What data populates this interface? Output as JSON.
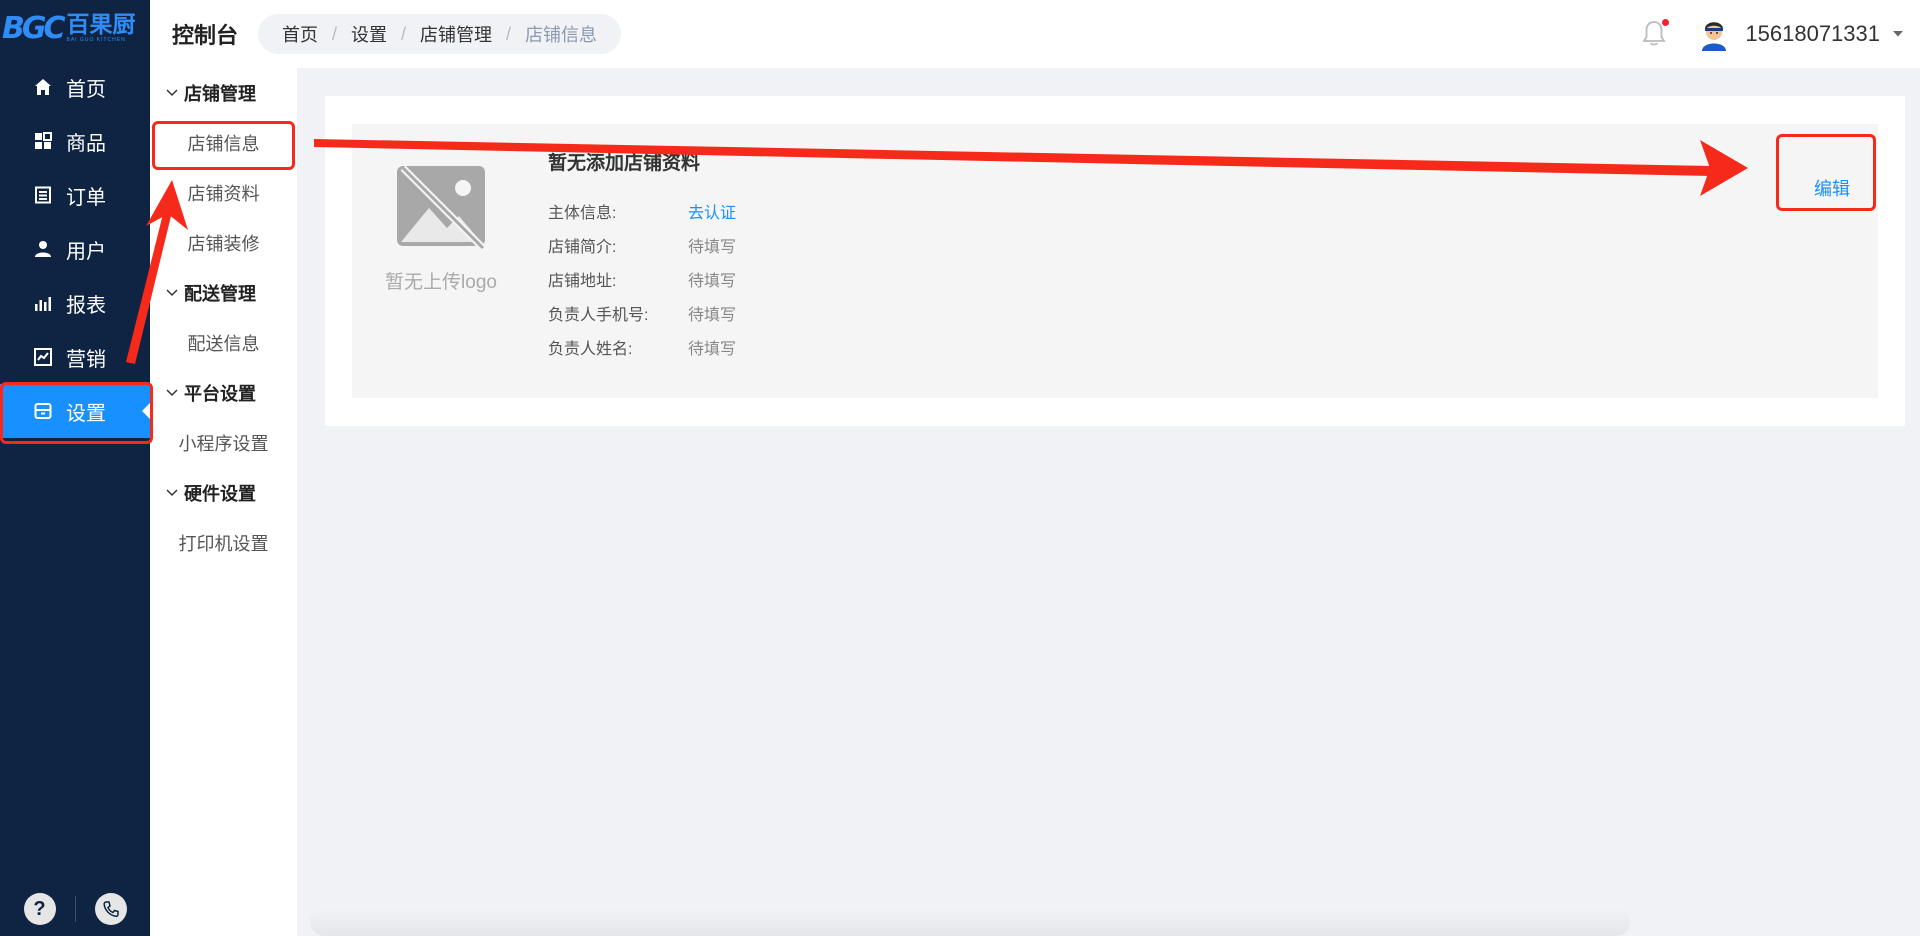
{
  "brand": {
    "mark": "BGC",
    "name_cn": "百果厨",
    "name_en": "BAI GUO KITCHEN",
    "color": "#2f8df8"
  },
  "sidebar": {
    "items": [
      {
        "label": "首页",
        "icon": "home-icon"
      },
      {
        "label": "商品",
        "icon": "grid-icon"
      },
      {
        "label": "订单",
        "icon": "order-list-icon"
      },
      {
        "label": "用户",
        "icon": "user-icon"
      },
      {
        "label": "报表",
        "icon": "bar-chart-icon"
      },
      {
        "label": "营销",
        "icon": "trend-chart-icon"
      },
      {
        "label": "设置",
        "icon": "store-settings-icon",
        "active": true
      }
    ],
    "footer": {
      "help": "?",
      "phone_icon": "phone-icon"
    }
  },
  "header": {
    "title": "控制台",
    "breadcrumb": [
      "首页",
      "设置",
      "店铺管理",
      "店铺信息"
    ],
    "user_phone": "15618071331",
    "notification_dot": true
  },
  "submenu": {
    "groups": [
      {
        "title": "店铺管理",
        "items": [
          "店铺信息",
          "店铺资料",
          "店铺装修"
        ]
      },
      {
        "title": "配送管理",
        "items": [
          "配送信息"
        ]
      },
      {
        "title": "平台设置",
        "items": [
          "小程序设置"
        ]
      },
      {
        "title": "硬件设置",
        "items": [
          "打印机设置"
        ]
      }
    ],
    "active_item": "店铺信息"
  },
  "shop": {
    "logo_placeholder": "暂无上传logo",
    "title": "暂无添加店铺资料",
    "edit_label": "编辑",
    "fields": [
      {
        "label": "主体信息:",
        "value": "去认证",
        "link": true
      },
      {
        "label": "店铺简介:",
        "value": "待填写"
      },
      {
        "label": "店铺地址:",
        "value": "待填写"
      },
      {
        "label": "负责人手机号:",
        "value": "待填写"
      },
      {
        "label": "负责人姓名:",
        "value": "待填写"
      }
    ]
  },
  "colors": {
    "sidebar_bg": "#0f2443",
    "accent": "#1890ff",
    "annotation": "#f52a1a"
  }
}
